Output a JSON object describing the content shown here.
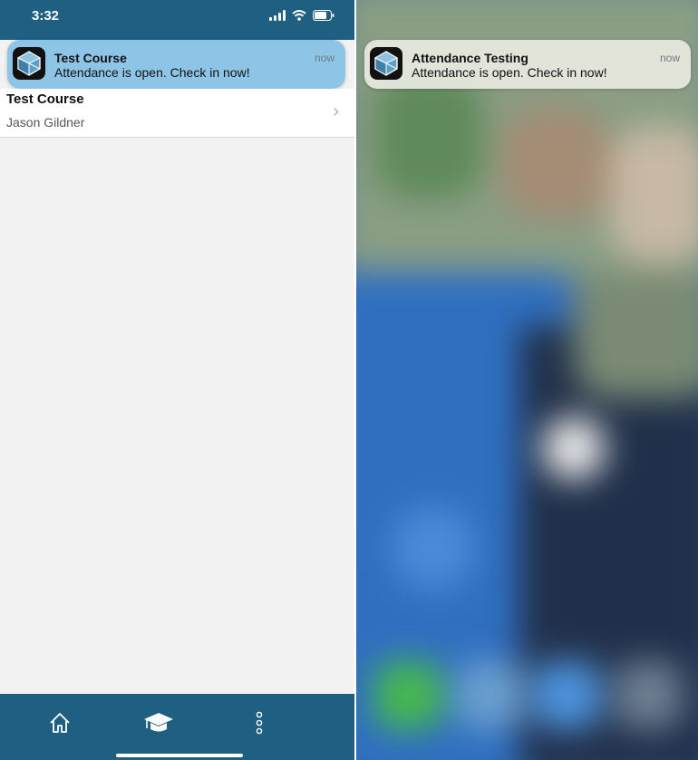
{
  "left_screen": {
    "status_bar": {
      "time": "3:32"
    },
    "notification": {
      "app_icon": "cube-app-icon",
      "title": "Test Course",
      "message": "Attendance is open. Check in now!",
      "time": "now"
    },
    "course_list": [
      {
        "name": "Test Course",
        "instructor": "Jason  Gildner"
      }
    ],
    "tab_bar": {
      "tabs": [
        {
          "icon": "home-icon"
        },
        {
          "icon": "graduation-cap-icon"
        },
        {
          "icon": "more-vertical-icon"
        }
      ]
    }
  },
  "right_screen": {
    "notification": {
      "app_icon": "cube-app-icon",
      "title": "Attendance Testing",
      "message": "Attendance is open. Check in now!",
      "time": "now"
    }
  },
  "colors": {
    "brand_blue": "#1f5f82",
    "banner_blue": "#8ec5e6",
    "list_background": "#f2f2f2"
  }
}
